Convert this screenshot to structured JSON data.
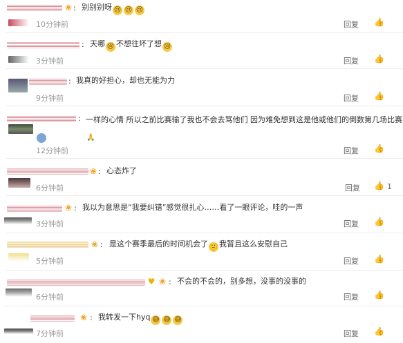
{
  "comments": [
    {
      "text": "别别别呀",
      "emojis": [
        "cry",
        "cry",
        "cry"
      ],
      "time": "10分钟前",
      "reply": "回复",
      "like": "👍",
      "like_count": ""
    },
    {
      "text_before": "天哪",
      "emoji": "cry",
      "text_after": "不想往坏了想",
      "emoji2": "cry",
      "time": "3分钟前",
      "reply": "回复",
      "like": "👍",
      "like_count": ""
    },
    {
      "text": "我真的好担心，却也无能为力",
      "time": "9分钟前",
      "reply": "回复",
      "like": "👍",
      "like_count": ""
    },
    {
      "text": "一样的心情 所以之前比赛输了我也不会去骂他们 因为难免想到这是他或他们的倒数第几场比赛",
      "emoji": "pray",
      "time": "12分钟前",
      "reply": "回复",
      "like": "👍",
      "like_count": ""
    },
    {
      "text": "心态炸了",
      "time": "6分钟前",
      "reply": "回复",
      "like": "👍",
      "like_count": "1"
    },
    {
      "text": "我以为意思是“我要纠错”感觉很扎心……看了一眼评论，哇的一声",
      "time": "3分钟前",
      "reply": "回复",
      "like": "👍",
      "like_count": ""
    },
    {
      "text_before": "是这个赛季最后的时间机会了",
      "emoji": "sad",
      "text_after": "我暂且这么安慰自己",
      "time": "5分钟前",
      "reply": "回复",
      "like": "👍",
      "like_count": ""
    },
    {
      "text": "不会的不会的，别多想，没事的没事的",
      "time": "6分钟前",
      "reply": "回复",
      "like": "👍",
      "like_count": ""
    },
    {
      "text": "我转发一下hyq",
      "emojis": [
        "sweat",
        "sweat",
        "sweat"
      ],
      "time": "7分钟前",
      "reply": "回复",
      "like": "👍",
      "like_count": ""
    }
  ],
  "colors": {
    "vip": "#f0a020",
    "emoji": "#f7c948",
    "divider": "#ececec"
  }
}
